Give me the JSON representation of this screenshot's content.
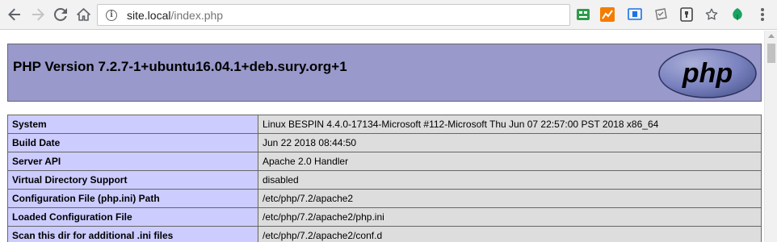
{
  "browser": {
    "url_host": "site.local",
    "url_path": "/index.php",
    "icons": {
      "back": "arrow-left-icon",
      "forward": "arrow-right-icon",
      "reload": "reload-icon",
      "home": "home-icon",
      "info": "info-icon",
      "bookmark": "star-icon",
      "menu": "vertical-dots-icon"
    }
  },
  "page": {
    "title": "PHP Version 7.2.7-1+ubuntu16.04.1+deb.sury.org+1",
    "logo_text": "php",
    "colors": {
      "header_bg": "#9999cc",
      "label_bg": "#ccccff",
      "value_bg": "#dddddd"
    },
    "rows": [
      {
        "label": "System",
        "value": "Linux BESPIN 4.4.0-17134-Microsoft #112-Microsoft Thu Jun 07 22:57:00 PST 2018 x86_64"
      },
      {
        "label": "Build Date",
        "value": "Jun 22 2018 08:44:50"
      },
      {
        "label": "Server API",
        "value": "Apache 2.0 Handler"
      },
      {
        "label": "Virtual Directory Support",
        "value": "disabled"
      },
      {
        "label": "Configuration File (php.ini) Path",
        "value": "/etc/php/7.2/apache2"
      },
      {
        "label": "Loaded Configuration File",
        "value": "/etc/php/7.2/apache2/php.ini"
      },
      {
        "label": "Scan this dir for additional .ini files",
        "value": "/etc/php/7.2/apache2/conf.d"
      }
    ]
  }
}
